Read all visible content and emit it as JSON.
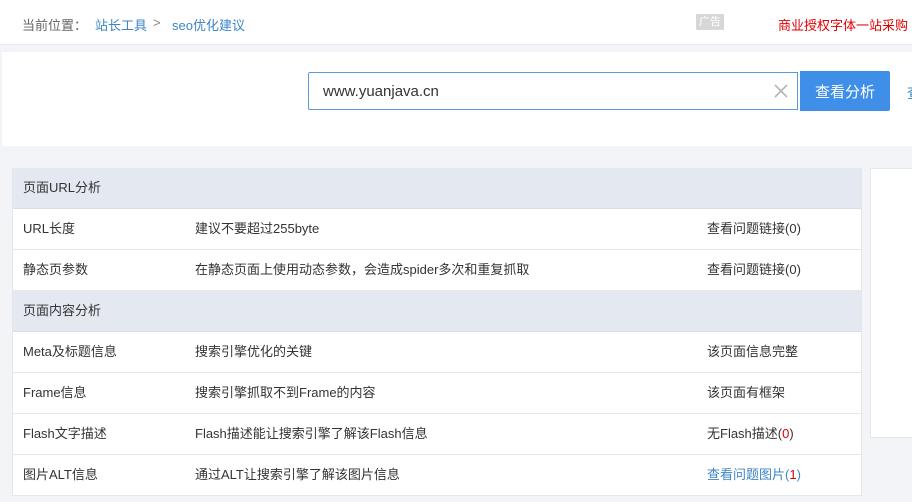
{
  "breadcrumb": {
    "prefix": "当前位置：",
    "items": [
      "站长工具",
      "seo优化建议"
    ],
    "separator": ">"
  },
  "ad": {
    "badge": "广告",
    "text": "商业授权字体一站采购"
  },
  "search": {
    "value": "www.yuanjava.cn",
    "button_label": "查看分析",
    "edge_link_text": "查"
  },
  "sections": [
    {
      "title": "页面URL分析",
      "rows": [
        {
          "name": "URL长度",
          "desc": "建议不要超过255byte",
          "status": "查看问题链接",
          "count": "(0)"
        },
        {
          "name": "静态页参数",
          "desc": "在静态页面上使用动态参数，会造成spider多次和重复抓取",
          "status": "查看问题链接",
          "count": "(0)"
        }
      ]
    },
    {
      "title": "页面内容分析",
      "rows": [
        {
          "name": "Meta及标题信息",
          "desc": "搜索引擎优化的关键",
          "status": "该页面信息完整"
        },
        {
          "name": "Frame信息",
          "desc": "搜索引擎抓取不到Frame的内容",
          "status": "该页面有框架"
        },
        {
          "name": "Flash文字描述",
          "desc": "Flash描述能让搜索引擎了解该Flash信息",
          "status": "无Flash描述",
          "paren_open": "(",
          "count_num": "0",
          "paren_close": ")"
        },
        {
          "name": "图片ALT信息",
          "desc": "通过ALT让搜索引擎了解该图片信息",
          "status": "查看问题图片",
          "paren_open": "(",
          "count_num": "1",
          "paren_close": ")"
        }
      ]
    }
  ],
  "colors": {
    "accent": "#3f8fe8",
    "link": "#3d85c6",
    "alert": "#e00000",
    "section_header_bg": "#e4e8f0"
  }
}
